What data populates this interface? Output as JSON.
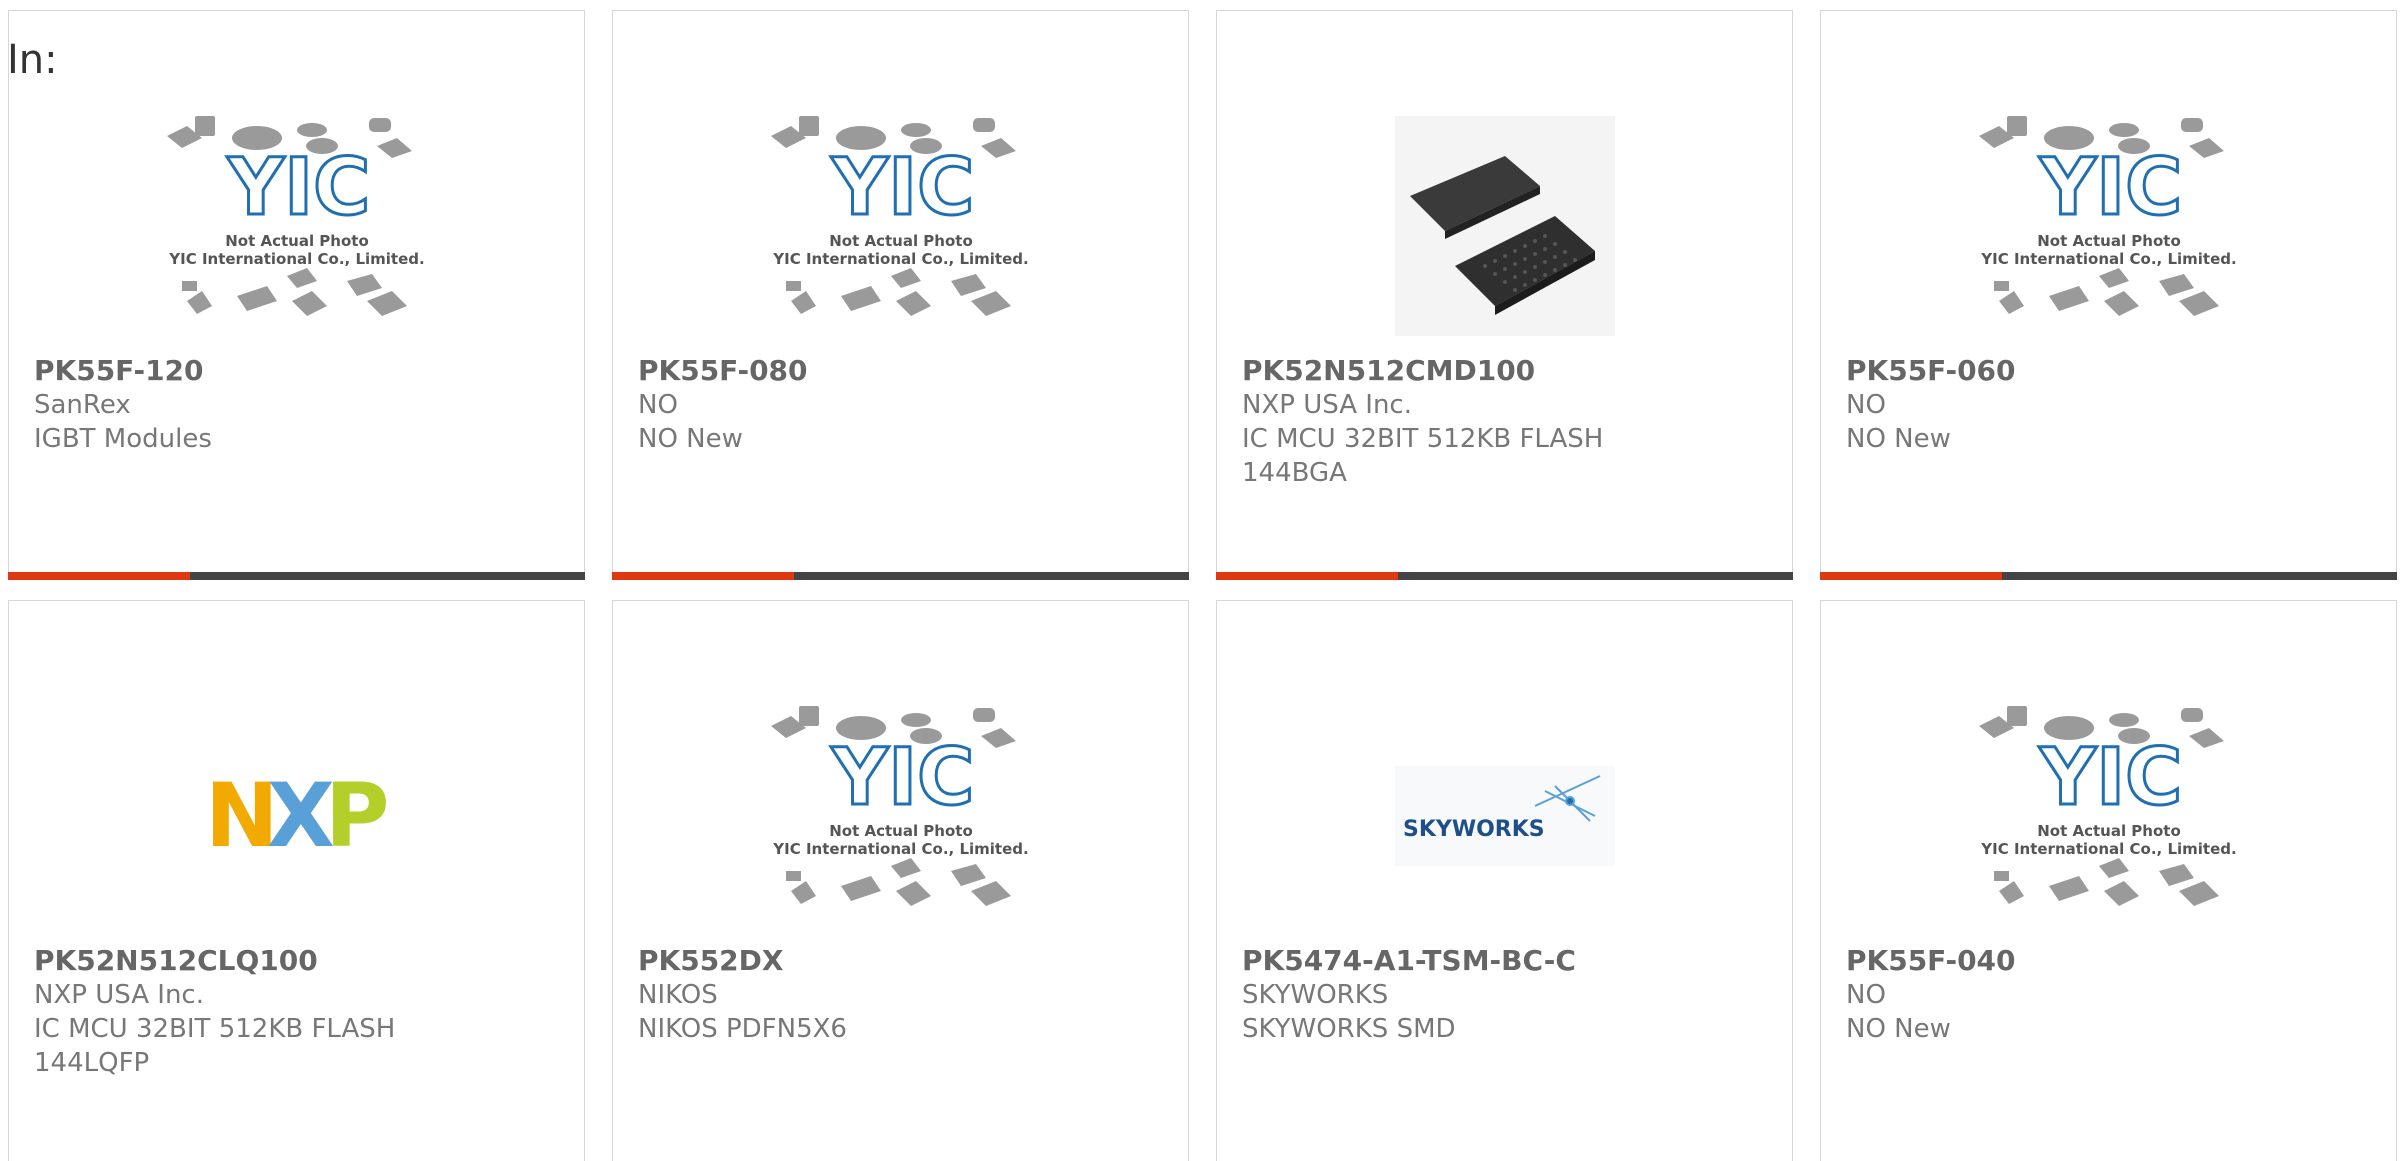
{
  "page": {
    "in_label": "In:"
  },
  "colors": {
    "accent_red": "#e2380f",
    "accent_dark": "#444444"
  },
  "placeholder": {
    "line1": "Not Actual Photo",
    "line2": "YIC International Co., Limited."
  },
  "cards": [
    {
      "part": "PK55F-120",
      "manufacturer": "SanRex",
      "desc1": "IGBT Modules",
      "desc2": "",
      "image": "yic-placeholder"
    },
    {
      "part": "PK55F-080",
      "manufacturer": "NO",
      "desc1": "NO New",
      "desc2": "",
      "image": "yic-placeholder"
    },
    {
      "part": "PK52N512CMD100",
      "manufacturer": "NXP USA Inc.",
      "desc1": "IC MCU 32BIT 512KB FLASH",
      "desc2": "144BGA",
      "image": "bga-chips-photo"
    },
    {
      "part": "PK55F-060",
      "manufacturer": "NO",
      "desc1": "NO New",
      "desc2": "",
      "image": "yic-placeholder"
    },
    {
      "part": "PK52N512CLQ100",
      "manufacturer": "NXP USA Inc.",
      "desc1": "IC MCU 32BIT 512KB FLASH",
      "desc2": "144LQFP",
      "image": "nxp-logo"
    },
    {
      "part": "PK552DX",
      "manufacturer": "NIKOS",
      "desc1": "NIKOS PDFN5X6",
      "desc2": "",
      "image": "yic-placeholder"
    },
    {
      "part": "PK5474-A1-TSM-BC-C",
      "manufacturer": "SKYWORKS",
      "desc1": "SKYWORKS SMD",
      "desc2": "",
      "image": "skyworks-logo"
    },
    {
      "part": "PK55F-040",
      "manufacturer": "NO",
      "desc1": "NO New",
      "desc2": "",
      "image": "yic-placeholder"
    }
  ],
  "logos": {
    "nxp": {
      "letter1": "N",
      "letter2": "X",
      "letter3": "P"
    },
    "skyworks": {
      "wordmark": "SKYWORKS"
    }
  }
}
